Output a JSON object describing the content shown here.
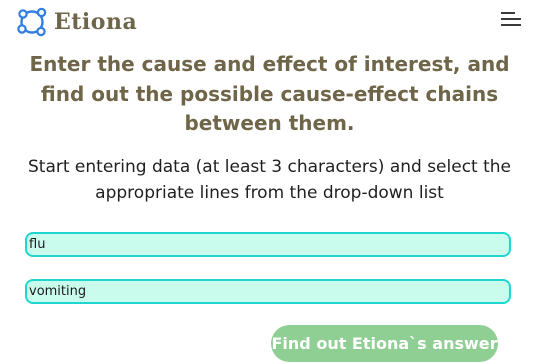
{
  "header": {
    "logo_text": "Etiona",
    "logo_icon": "molecule-ring-icon",
    "menu_icon": "hamburger-menu-icon"
  },
  "main": {
    "headline": "Enter the cause and effect of interest, and find out the possible cause-effect chains between them.",
    "instructions": "Start entering data (at least 3 characters) and select the appropriate lines from the drop-down list",
    "cause_input": {
      "value": "flu"
    },
    "effect_input": {
      "value": "vomiting"
    },
    "find_button_label": "Find out Etiona`s answer"
  },
  "colors": {
    "brand_text": "#6f6548",
    "logo_ring": "#2f7ee0",
    "input_background": "#c9fcec",
    "input_border": "#1ed6cf",
    "button_background": "#8fcf93"
  }
}
